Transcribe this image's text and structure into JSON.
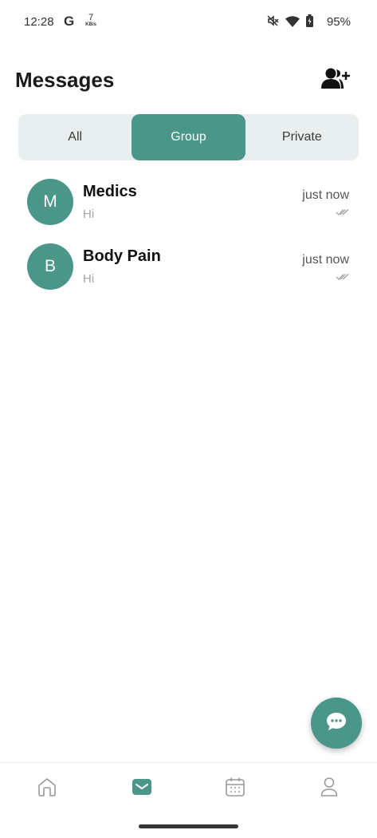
{
  "status_bar": {
    "time": "12:28",
    "g_label": "G",
    "speed_value": "7",
    "speed_unit": "KB/s",
    "battery": "95%",
    "icons": [
      "mute-icon",
      "wifi-icon",
      "battery-icon"
    ]
  },
  "header": {
    "title": "Messages",
    "add_user_icon": "add-user-icon"
  },
  "tabs": [
    {
      "label": "All",
      "active": false
    },
    {
      "label": "Group",
      "active": true
    },
    {
      "label": "Private",
      "active": false
    }
  ],
  "chats": [
    {
      "initial": "M",
      "name": "Medics",
      "preview": "Hi",
      "time": "just now"
    },
    {
      "initial": "B",
      "name": "Body Pain",
      "preview": "Hi",
      "time": "just now"
    }
  ],
  "fab": {
    "icon": "chat-bubble-icon"
  },
  "bottom_nav": {
    "items": [
      "home-icon",
      "messages-icon",
      "calendar-icon",
      "profile-icon"
    ],
    "active": "messages-icon"
  },
  "colors": {
    "accent": "#4a9689",
    "tab_bg": "#e9efee",
    "muted_text": "#a8a8a8"
  }
}
